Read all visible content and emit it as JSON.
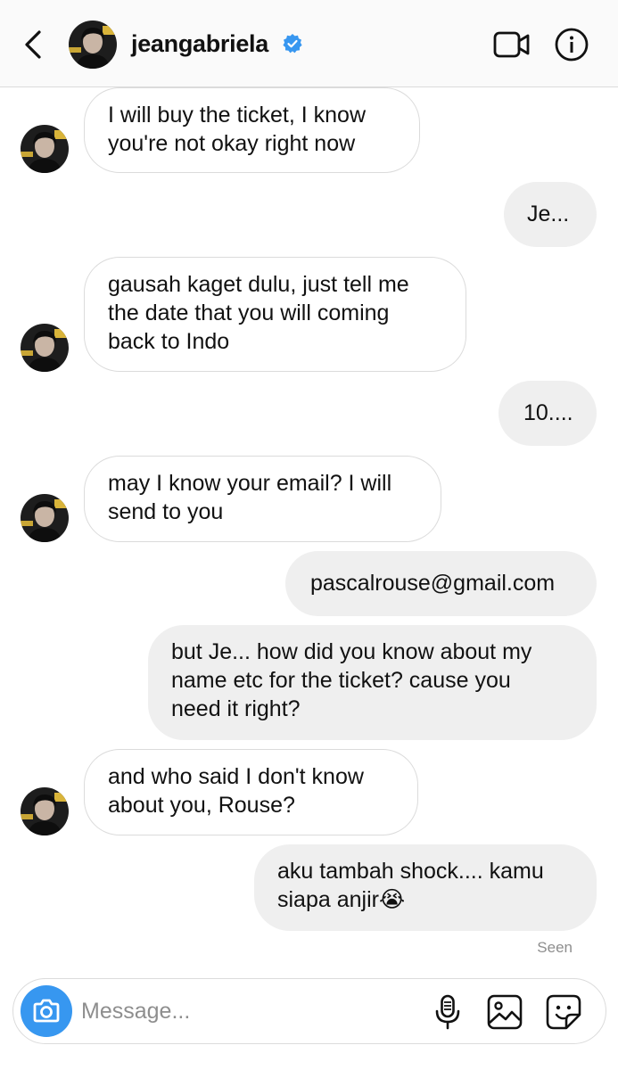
{
  "header": {
    "username": "jeangabriela",
    "verified": true,
    "icons": [
      "back-chevron-icon",
      "verified-badge-icon",
      "video-call-icon",
      "info-icon"
    ]
  },
  "messages": [
    {
      "sender": "them",
      "text": "I will buy the ticket, I know\nyou're not okay right now"
    },
    {
      "sender": "me",
      "text": "Je..."
    },
    {
      "sender": "them",
      "text": "gausah kaget dulu, just tell me\nthe date that you will coming\nback to Indo"
    },
    {
      "sender": "me",
      "text": "10...."
    },
    {
      "sender": "them",
      "text": "may I know your email? I will\nsend to you"
    },
    {
      "sender": "me",
      "text": "pascalrouse@gmail.com"
    },
    {
      "sender": "me",
      "text": "but Je... how did you know about my\nname etc for the ticket? cause you\nneed it right?"
    },
    {
      "sender": "them",
      "text": "and who said I don't know\nabout you, Rouse?"
    },
    {
      "sender": "me",
      "text": "aku tambah shock.... kamu\nsiapa anjir😭"
    }
  ],
  "status": {
    "seen": "Seen"
  },
  "composer": {
    "placeholder": "Message...",
    "icons": [
      "camera-icon",
      "microphone-icon",
      "gallery-icon",
      "sticker-icon"
    ]
  },
  "colors": {
    "accent": "#3797f0",
    "incoming_border": "#dbdbdb",
    "outgoing_bg": "#efefef",
    "verified": "#3897f0"
  }
}
